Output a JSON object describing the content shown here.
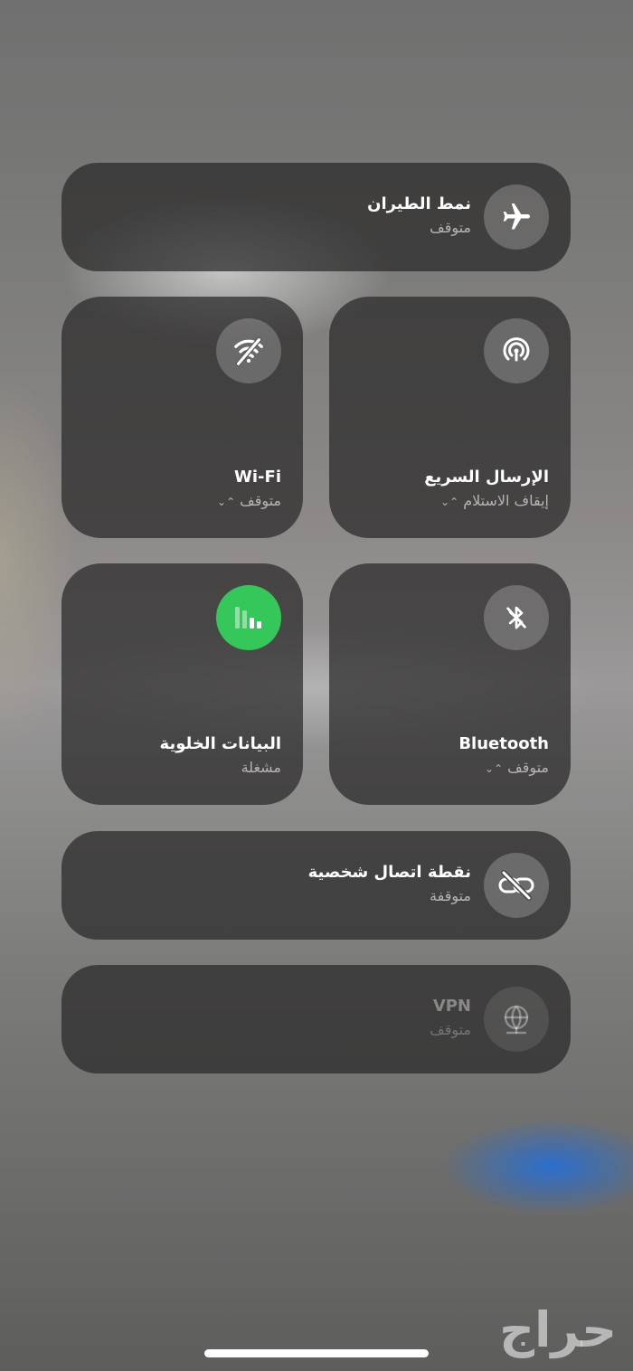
{
  "airplane": {
    "title": "نمط الطيران",
    "status": "متوقف",
    "icon": "airplane-icon"
  },
  "airdrop": {
    "title": "الإرسال السريع",
    "status": "إيقاف الاستلام",
    "icon": "airdrop-icon"
  },
  "wifi": {
    "title": "Wi-Fi",
    "status": "متوقف",
    "icon": "wifi-off-icon"
  },
  "bluetooth": {
    "title": "Bluetooth",
    "status": "متوقف",
    "icon": "bluetooth-off-icon"
  },
  "cellular": {
    "title": "البيانات الخلوية",
    "status": "مشغلة",
    "icon": "cellular-bars-icon",
    "accent": "#35c759"
  },
  "hotspot": {
    "title": "نقطة اتصال شخصية",
    "status": "متوقفة",
    "icon": "hotspot-off-icon"
  },
  "vpn": {
    "title": "VPN",
    "status": "متوقف",
    "icon": "vpn-globe-icon"
  },
  "watermark": {
    "text": "حراج"
  },
  "chevron": "⌃⌄"
}
